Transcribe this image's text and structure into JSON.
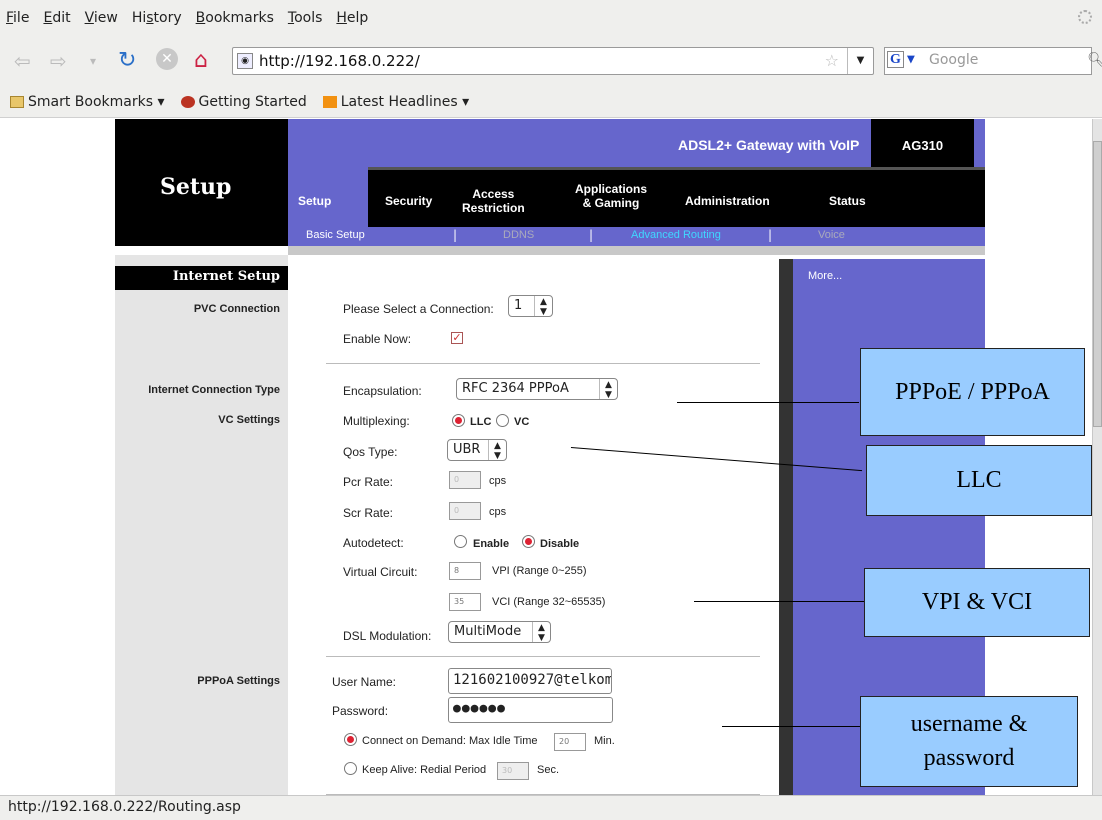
{
  "browser": {
    "menu": [
      "File",
      "Edit",
      "View",
      "History",
      "Bookmarks",
      "Tools",
      "Help"
    ],
    "menu_mnemonics": [
      "F",
      "E",
      "V",
      "s",
      "B",
      "T",
      "H"
    ],
    "url": "http://192.168.0.222/",
    "search_engine": "G",
    "search_placeholder": "Google",
    "bookmarks": [
      "Smart Bookmarks",
      "Getting Started",
      "Latest Headlines"
    ],
    "status_text": "http://192.168.0.222/Routing.asp"
  },
  "router": {
    "banner": "ADSL2+ Gateway with VoIP",
    "model": "AG310",
    "section_title": "Setup",
    "tabs": [
      {
        "label": "Setup"
      },
      {
        "label": "Security"
      },
      {
        "label": "Access\nRestriction"
      },
      {
        "label": "Applications\n& Gaming"
      },
      {
        "label": "Administration"
      },
      {
        "label": "Status"
      }
    ],
    "subtabs": [
      "Basic Setup",
      "DDNS",
      "Advanced Routing",
      "Voice"
    ],
    "subtab_sep": "|",
    "left_header": "Internet Setup",
    "left_labels": {
      "pvc": "PVC Connection",
      "conn_type": "Internet Connection Type",
      "vc": "VC Settings",
      "pppoa": "PPPoA Settings"
    },
    "more": "More...",
    "form": {
      "select_conn_label": "Please Select a Connection:",
      "select_conn_value": "1",
      "enable_now_label": "Enable Now:",
      "encapsulation_label": "Encapsulation:",
      "encapsulation_value": "RFC 2364 PPPoA",
      "multiplexing_label": "Multiplexing:",
      "mux_llc": "LLC",
      "mux_vc": "VC",
      "qos_label": "Qos Type:",
      "qos_value": "UBR",
      "pcr_label": "Pcr Rate:",
      "pcr_value": "0",
      "pcr_unit": "cps",
      "scr_label": "Scr Rate:",
      "scr_value": "0",
      "scr_unit": "cps",
      "autodetect_label": "Autodetect:",
      "auto_enable": "Enable",
      "auto_disable": "Disable",
      "vc_label": "Virtual Circuit:",
      "vpi_value": "8",
      "vpi_range": "VPI (Range 0~255)",
      "vci_value": "35",
      "vci_range": "VCI (Range 32~65535)",
      "dsl_label": "DSL Modulation:",
      "dsl_value": "MultiMode",
      "username_label": "User Name:",
      "username_value": "121602100927@telkom",
      "password_label": "Password:",
      "password_value": "●●●●●●",
      "cod_label": "Connect on Demand: Max Idle Time",
      "cod_value": "20",
      "cod_unit": "Min.",
      "ka_label": "Keep Alive: Redial Period",
      "ka_value": "30",
      "ka_unit": "Sec."
    }
  },
  "annotations": {
    "pppoe": "PPPoE / PPPoA",
    "llc": "LLC",
    "vpi_vci": "VPI & VCI",
    "userpass": "username &\npassword"
  }
}
